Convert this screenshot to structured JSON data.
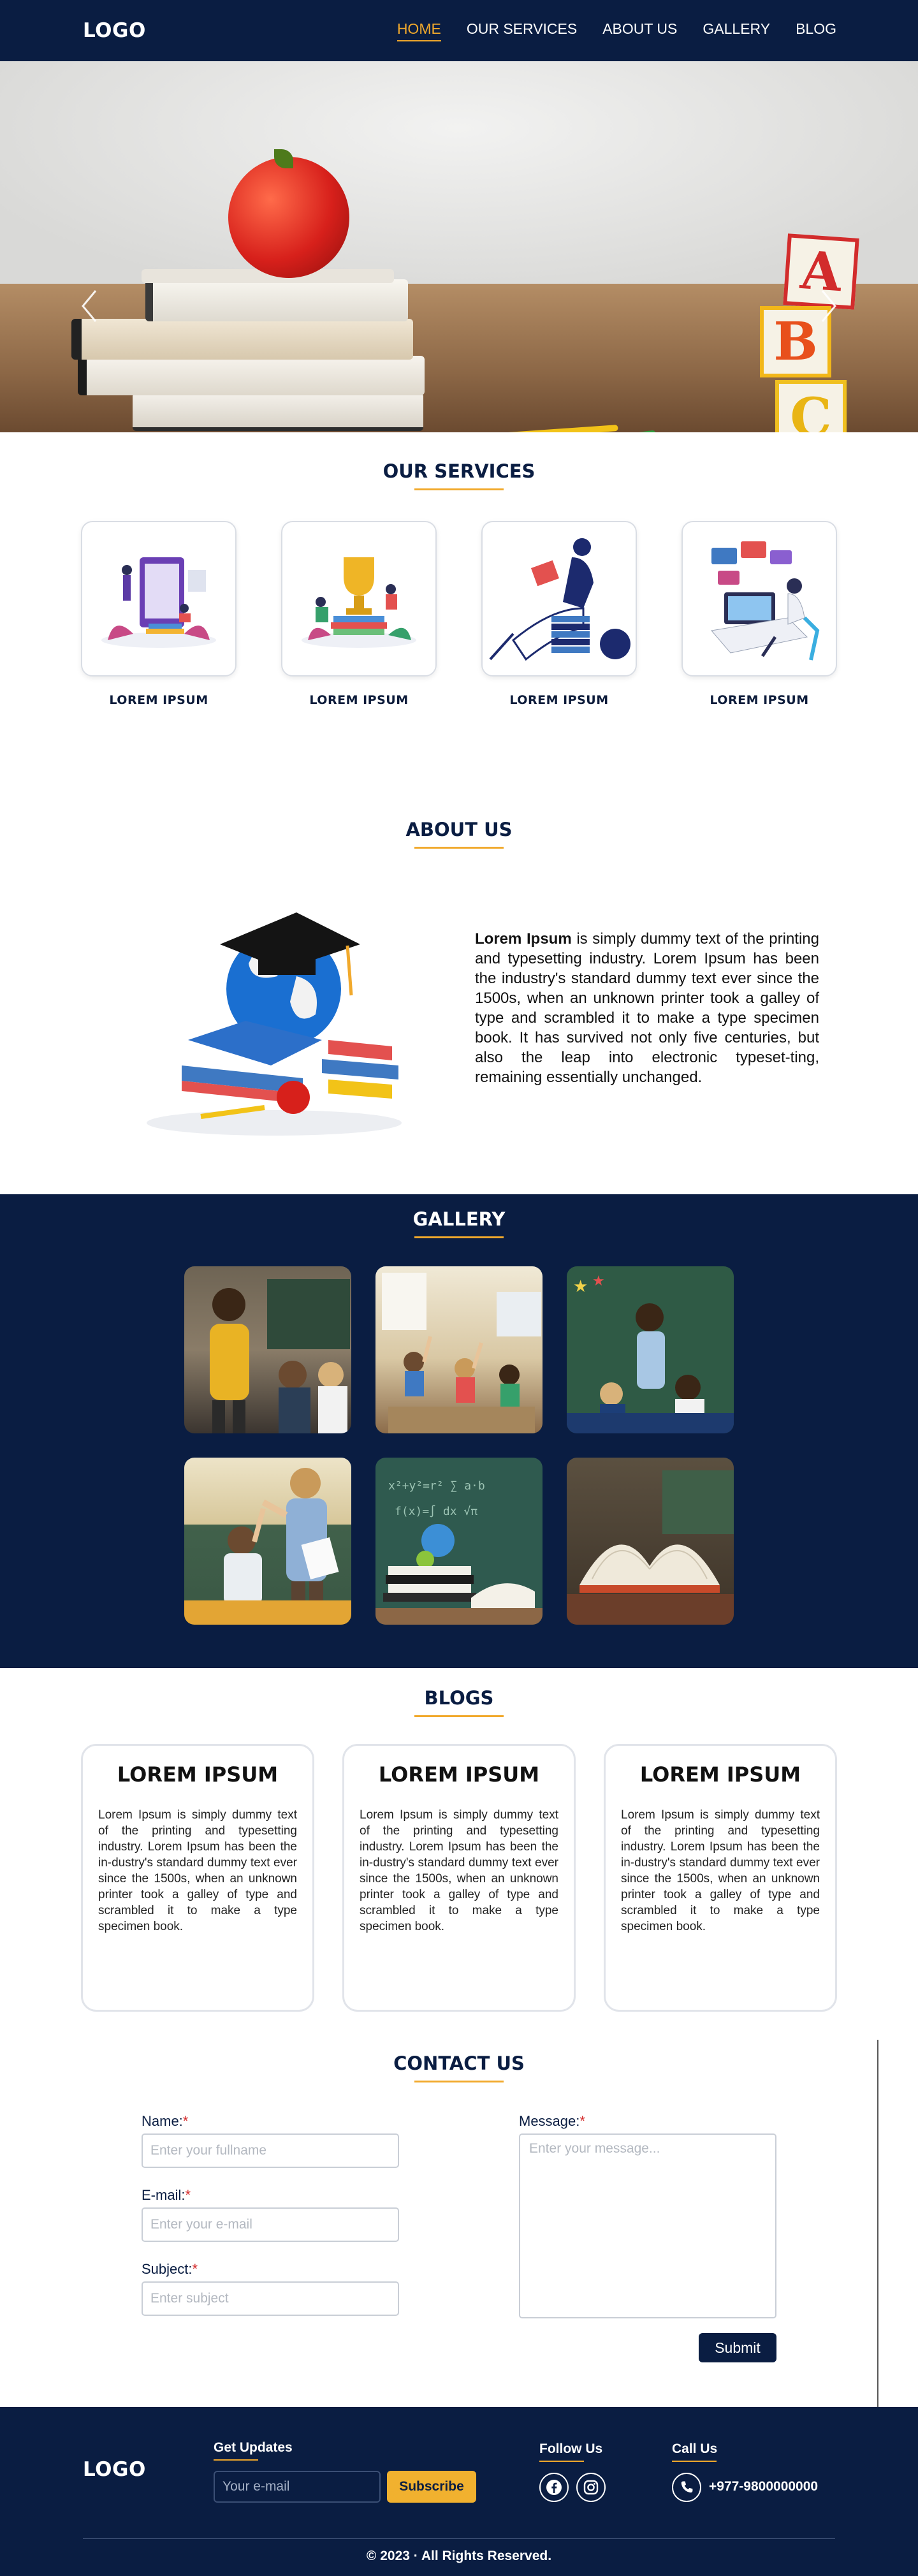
{
  "nav": {
    "logo": "LOGO",
    "links": [
      "HOME",
      "OUR SERVICES",
      "ABOUT US",
      "GALLERY",
      "BLOG"
    ],
    "active_index": 0
  },
  "hero": {
    "block_letters": [
      "A",
      "B",
      "C"
    ],
    "prev_icon": "chevron-left-icon",
    "next_icon": "chevron-right-icon",
    "slide_count": 2,
    "active_slide": 1
  },
  "services": {
    "title": "OUR SERVICES",
    "items": [
      {
        "label": "LOREM IPSUM",
        "icon": "online-learning-illustration"
      },
      {
        "label": "LOREM IPSUM",
        "icon": "trophy-reading-illustration"
      },
      {
        "label": "LOREM IPSUM",
        "icon": "reading-student-illustration"
      },
      {
        "label": "LOREM IPSUM",
        "icon": "desk-computer-illustration"
      }
    ]
  },
  "about": {
    "title": "ABOUT US",
    "lead": "Lorem Ipsum",
    "text": " is simply dummy text of the printing and typesetting industry. Lorem Ipsum has been the industry's standard dummy text ever since the 1500s, when an unknown printer took a galley of type and scrambled it to make a type specimen book. It has survived not only five centuries, but also the leap into electronic typeset-ting, remaining essentially unchanged."
  },
  "gallery": {
    "title": "GALLERY",
    "items": [
      "teacher-with-students",
      "students-raising-hands",
      "teacher-at-chalkboard",
      "teacher-high-five",
      "globe-on-books",
      "open-book-laptop"
    ]
  },
  "blogs": {
    "title": "BLOGS",
    "items": [
      {
        "title": "LOREM IPSUM",
        "text": "Lorem Ipsum is simply dummy text of the printing and typesetting industry. Lorem Ipsum has been the in-dustry's standard dummy text ever since the 1500s, when an unknown printer took a galley of type and scrambled it to make a type specimen book."
      },
      {
        "title": "LOREM IPSUM",
        "text": "Lorem Ipsum is simply dummy text of the printing and typesetting industry. Lorem Ipsum has been the in-dustry's standard dummy text ever since the 1500s, when an unknown printer took a galley of type and scrambled it to make a type specimen book."
      },
      {
        "title": "LOREM IPSUM",
        "text": "Lorem Ipsum is simply dummy text of the printing and typesetting industry. Lorem Ipsum has been the in-dustry's standard dummy text ever since the 1500s, when an unknown printer took a galley of type and scrambled it to make a type specimen book."
      }
    ]
  },
  "contact": {
    "title": "CONTACT US",
    "name_label": "Name:",
    "name_placeholder": "Enter your fullname",
    "email_label": "E-mail:",
    "email_placeholder": "Enter your e-mail",
    "subject_label": "Subject:",
    "subject_placeholder": "Enter subject",
    "message_label": "Message:",
    "message_placeholder": "Enter your message...",
    "required_mark": "*",
    "submit": "Submit"
  },
  "footer": {
    "logo": "LOGO",
    "updates_title": "Get Updates",
    "email_placeholder": "Your e-mail",
    "subscribe": "Subscribe",
    "follow_title": "Follow Us",
    "social_icons": [
      "facebook-icon",
      "instagram-icon"
    ],
    "call_title": "Call Us",
    "phone": "+977-9800000000",
    "copyright": "© 2023 · All Rights Reserved."
  },
  "colors": {
    "navy": "#0a1d42",
    "accent": "#f1a92c"
  }
}
